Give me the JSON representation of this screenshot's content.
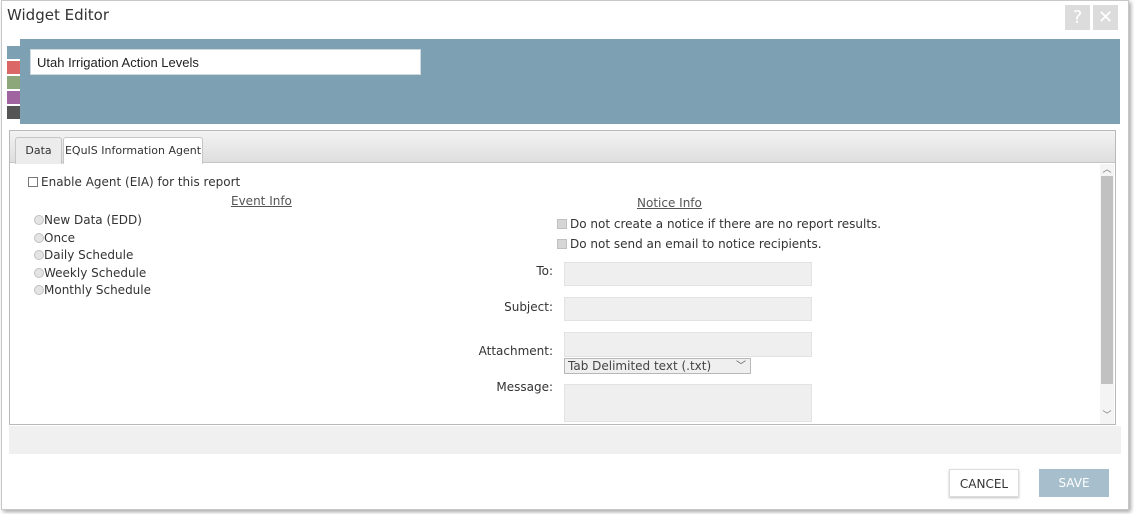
{
  "window": {
    "title": "Widget Editor",
    "help_glyph": "?",
    "close_glyph": "✕"
  },
  "colors": {
    "banner": "#7ea0b3",
    "swatches": [
      "#7ea0b3",
      "#dc6767",
      "#8da77b",
      "#a064a0",
      "#555555"
    ],
    "save_button": "#a7bfcc"
  },
  "widget": {
    "name_value": "Utah Irrigation Action Levels"
  },
  "tabs": [
    {
      "label": "Data",
      "active": false
    },
    {
      "label": "EQuIS Information Agent",
      "active": true
    }
  ],
  "eia": {
    "enable_label": "Enable Agent (EIA) for this report",
    "event_info": {
      "heading": "Event Info",
      "options": [
        "New Data (EDD)",
        "Once",
        "Daily Schedule",
        "Weekly Schedule",
        "Monthly Schedule"
      ]
    },
    "notice_info": {
      "heading": "Notice Info",
      "no_notice_label": "Do not create a notice if there are no report results.",
      "no_email_label": "Do not send an email to notice recipients.",
      "to_label": "To:",
      "subject_label": "Subject:",
      "attachment_label": "Attachment:",
      "attachment_format": "Tab Delimited text (.txt)",
      "message_label": "Message:"
    }
  },
  "footer": {
    "cancel_label": "CANCEL",
    "save_label": "SAVE"
  }
}
